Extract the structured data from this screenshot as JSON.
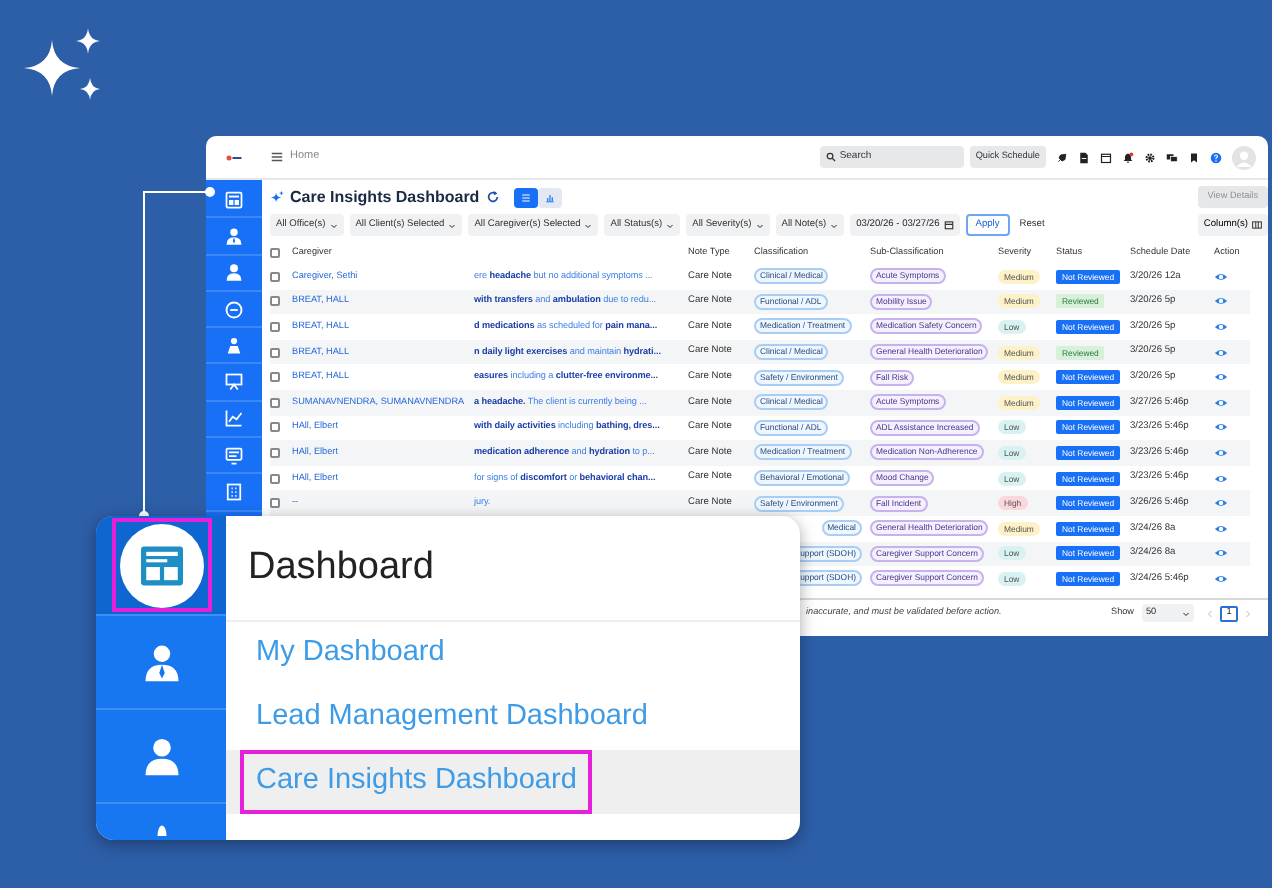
{
  "app": {
    "header": {
      "home_label": "Home",
      "search": {
        "placeholder": "Search"
      },
      "quick_schedule": "Quick Schedule"
    },
    "page_title": "Care Insights Dashboard",
    "view_toggle": [
      {
        "kind": "list",
        "selected": true
      },
      {
        "kind": "chart",
        "selected": false
      }
    ],
    "view_details": {
      "label": "View Details",
      "disabled": true
    },
    "filters": [
      "All Office(s)",
      "All Client(s) Selected",
      "All Caregiver(s) Selected",
      "All Status(s)",
      "All Severity(s)",
      "All Note(s)"
    ],
    "date_range": "03/20/26 - 03/27/26",
    "apply": "Apply",
    "reset": "Reset",
    "columns_button": "Column(s)",
    "table": {
      "select_all_checked": false,
      "columns": [
        "Caregiver",
        "Note Type",
        "Classification",
        "Sub-Classification",
        "Severity",
        "Status",
        "Schedule Date",
        "Action"
      ],
      "rows": [
        {
          "checked": false,
          "caregiver": "Caregiver, Sethi",
          "note": "ere **headache** but no additional symptoms ...",
          "note_type": "Care Note",
          "classification": "Clinical / Medical",
          "sub_classification": "Acute Symptoms",
          "severity": {
            "label": "Medium",
            "color": "#fdf1c7"
          },
          "status": {
            "label": "Not Reviewed",
            "reviewed": false
          },
          "schedule_date": "3/20/26 12a"
        },
        {
          "checked": false,
          "caregiver": "BREAT, HALL",
          "note": "**with transfers** and **ambulation** due to redu...",
          "note_type": "Care Note",
          "classification": "Functional / ADL",
          "sub_classification": "Mobility Issue",
          "severity": {
            "label": "Medium",
            "color": "#fdf1c7"
          },
          "status": {
            "label": "Reviewed",
            "reviewed": true
          },
          "schedule_date": "3/20/26 5p"
        },
        {
          "checked": false,
          "caregiver": "BREAT, HALL",
          "note": "**d medications** as scheduled for **pain mana...**",
          "note_type": "Care Note",
          "classification": "Medication / Treatment",
          "sub_classification": "Medication Safety Concern",
          "severity": {
            "label": "Low",
            "color": "#d8f1f1"
          },
          "status": {
            "label": "Not Reviewed",
            "reviewed": false
          },
          "schedule_date": "3/20/26 5p"
        },
        {
          "checked": false,
          "caregiver": "BREAT, HALL",
          "note": "**n daily light exercises** and maintain **hydrati...**",
          "note_type": "Care Note",
          "classification": "Clinical / Medical",
          "sub_classification": "General Health Deterioration",
          "severity": {
            "label": "Medium",
            "color": "#fdf1c7"
          },
          "status": {
            "label": "Reviewed",
            "reviewed": true
          },
          "schedule_date": "3/20/26 5p"
        },
        {
          "checked": false,
          "caregiver": "BREAT, HALL",
          "note": "**easures** including a **clutter-free environme...**",
          "note_type": "Care Note",
          "classification": "Safety / Environment",
          "sub_classification": "Fall Risk",
          "severity": {
            "label": "Medium",
            "color": "#fdf1c7"
          },
          "status": {
            "label": "Not Reviewed",
            "reviewed": false
          },
          "schedule_date": "3/20/26 5p"
        },
        {
          "checked": false,
          "caregiver": "SUMANAVNENDRA, SUMANAVNENDRA",
          "note": "**a headache.** The client is currently being ...",
          "note_type": "Care Note",
          "classification": "Clinical / Medical",
          "sub_classification": "Acute Symptoms",
          "severity": {
            "label": "Medium",
            "color": "#fdf1c7"
          },
          "status": {
            "label": "Not Reviewed",
            "reviewed": false
          },
          "schedule_date": "3/27/26 5:46p"
        },
        {
          "checked": false,
          "caregiver": "HAll, Elbert",
          "note": "**with daily activities** including **bathing, dres...**",
          "note_type": "Care Note",
          "classification": "Functional / ADL",
          "sub_classification": "ADL Assistance Increased",
          "severity": {
            "label": "Low",
            "color": "#d8f1f1"
          },
          "status": {
            "label": "Not Reviewed",
            "reviewed": false
          },
          "schedule_date": "3/23/26 5:46p"
        },
        {
          "checked": false,
          "caregiver": "HAll, Elbert",
          "note": "**medication adherence** and **hydration** to p...",
          "note_type": "Care Note",
          "classification": "Medication / Treatment",
          "sub_classification": "Medication Non-Adherence",
          "severity": {
            "label": "Low",
            "color": "#d8f1f1"
          },
          "status": {
            "label": "Not Reviewed",
            "reviewed": false
          },
          "schedule_date": "3/23/26 5:46p"
        },
        {
          "checked": false,
          "caregiver": "HAll, Elbert",
          "note": "for signs of **discomfort** or **behavioral chan...**",
          "note_type": "Care Note",
          "classification": "Behavioral / Emotional",
          "sub_classification": "Mood Change",
          "severity": {
            "label": "Low",
            "color": "#d8f1f1"
          },
          "status": {
            "label": "Not Reviewed",
            "reviewed": false
          },
          "schedule_date": "3/23/26 5:46p"
        },
        {
          "checked": false,
          "caregiver": "--",
          "note": "jury.",
          "note_type": "Care Note",
          "classification": "Safety / Environment",
          "sub_classification": "Fall Incident",
          "severity": {
            "label": "High",
            "color": "#fbd6dd"
          },
          "status": {
            "label": "Not Reviewed",
            "reviewed": false
          },
          "schedule_date": "3/26/26 5:46p"
        },
        {
          "classification": "Medical",
          "sub_classification": "General Health Deterioration",
          "severity": {
            "label": "Medium",
            "color": "#fdf1c7"
          },
          "status": {
            "label": "Not Reviewed",
            "reviewed": false
          },
          "schedule_date": "3/24/26 8a"
        },
        {
          "classification": "upport (SDOH)",
          "sub_classification": "Caregiver Support Concern",
          "severity": {
            "label": "Low",
            "color": "#d8f1f1"
          },
          "status": {
            "label": "Not Reviewed",
            "reviewed": false
          },
          "schedule_date": "3/24/26 8a"
        },
        {
          "classification": "upport (SDOH)",
          "sub_classification": "Caregiver Support Concern",
          "severity": {
            "label": "Low",
            "color": "#d8f1f1"
          },
          "status": {
            "label": "Not Reviewed",
            "reviewed": false
          },
          "schedule_date": "3/24/26 5:46p"
        }
      ]
    },
    "footer": {
      "note": "inaccurate, and must be validated before action.",
      "show_label": "Show",
      "page_size": "50",
      "pages": [
        {
          "label": "1",
          "selected": true
        }
      ]
    }
  },
  "callout": {
    "sidebar": [
      {
        "kind": "dashboard",
        "selected": true
      },
      {
        "kind": "manager",
        "selected": false
      },
      {
        "kind": "person",
        "selected": false
      },
      {
        "kind": "partial",
        "selected": false
      }
    ],
    "title": "Dashboard",
    "items": [
      {
        "label": "My Dashboard",
        "selected": false
      },
      {
        "label": "Lead Management Dashboard",
        "selected": false
      },
      {
        "label": "Care Insights Dashboard",
        "selected": true
      }
    ]
  }
}
